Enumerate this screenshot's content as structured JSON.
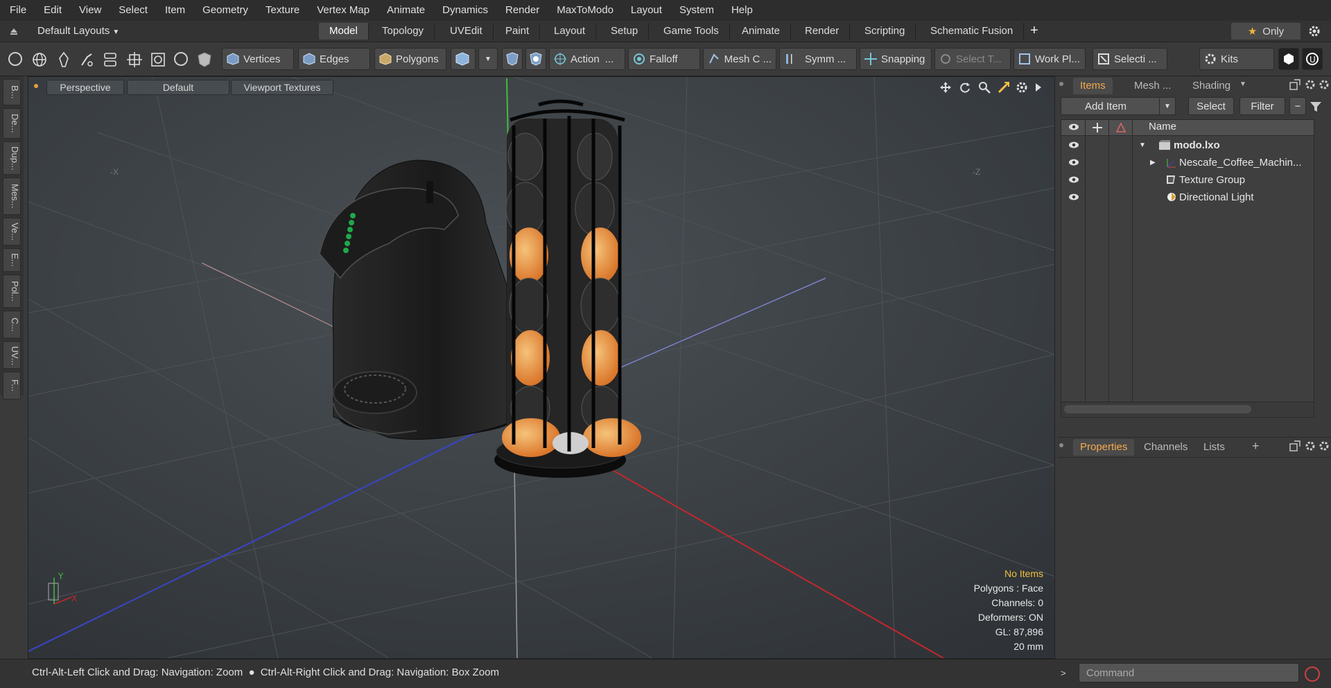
{
  "menu": [
    "File",
    "Edit",
    "View",
    "Select",
    "Item",
    "Geometry",
    "Texture",
    "Vertex Map",
    "Animate",
    "Dynamics",
    "Render",
    "MaxToModo",
    "Layout",
    "System",
    "Help"
  ],
  "layout": {
    "preset": "Default Layouts",
    "tabs": [
      "Model",
      "Topology",
      "UVEdit",
      "Paint",
      "Layout",
      "Setup",
      "Game Tools",
      "Animate",
      "Render",
      "Scripting",
      "Schematic Fusion"
    ],
    "active_tab": "Model",
    "only_label": "Only"
  },
  "toolbar": {
    "vertices": "Vertices",
    "edges": "Edges",
    "polygons": "Polygons",
    "action": "Action",
    "falloff": "Falloff",
    "mesh": "Mesh C ...",
    "symm": "Symm ...",
    "snapping": "Snapping",
    "select_t": "Select T...",
    "work_pl": "Work Pl...",
    "selecti": "Selecti ...",
    "kits": "Kits"
  },
  "left_tabs": [
    "B...",
    "De...",
    "Dup...",
    "Mes...",
    "Ve...",
    "E...",
    "Pol...",
    "C...",
    "UV...",
    "F..."
  ],
  "viewport": {
    "view": "Perspective",
    "shading": "Default",
    "textures": "Viewport Textures",
    "axis_x_label": "-X",
    "axis_z_label": "-Z",
    "info": {
      "items": "No Items",
      "polygons": "Polygons : Face",
      "channels": "Channels: 0",
      "deformers": "Deformers: ON",
      "gl": "GL: 87,896",
      "scale": "20 mm"
    },
    "colors": {
      "x_axis": "#c2272d",
      "y_axis": "#3fbf3f",
      "z_axis": "#3440c8",
      "warning": "#f0c040"
    }
  },
  "items_panel": {
    "tabs": [
      "Items",
      "Mesh ...",
      "Shading"
    ],
    "add_item": "Add Item",
    "select": "Select",
    "filter": "Filter",
    "name_header": "Name",
    "rows": [
      {
        "label": "modo.lxo",
        "icon": "scene-icon"
      },
      {
        "label": "Nescafe_Coffee_Machin...",
        "icon": "mesh-locator-icon"
      },
      {
        "label": "Texture Group",
        "icon": "texture-group-icon"
      },
      {
        "label": "Directional Light",
        "icon": "light-icon"
      }
    ]
  },
  "properties_panel": {
    "tabs": [
      "Properties",
      "Channels",
      "Lists"
    ]
  },
  "status": {
    "hint_left": "Ctrl-Alt-Left Click and Drag: Navigation: Zoom",
    "hint_right": "Ctrl-Alt-Right Click and Drag: Navigation: Box Zoom",
    "command_placeholder": "Command"
  }
}
